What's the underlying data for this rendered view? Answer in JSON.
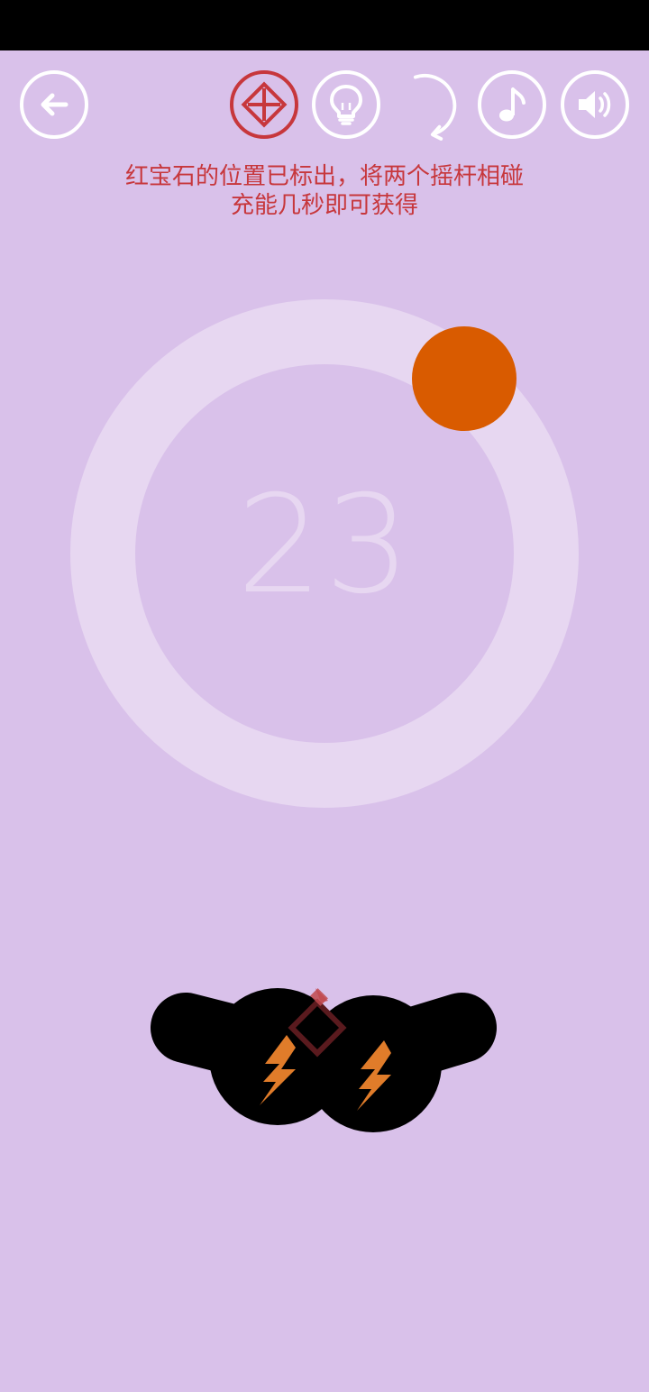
{
  "hint": {
    "line1": "红宝石的位置已标出，将两个摇杆相碰",
    "line2": "充能几秒即可获得"
  },
  "game": {
    "counter": "23",
    "ring_progress": 1.0
  },
  "toolbar": {
    "icons": [
      "back-arrow-icon",
      "ruby-target-icon",
      "lightbulb-icon",
      "restart-icon",
      "music-note-icon",
      "speaker-icon"
    ]
  },
  "colors": {
    "background": "#d9c1ea",
    "ring": "#e7d7f1",
    "orb": "#d95b00",
    "hint_text": "#c7373c",
    "ruby_button": "#c7373c",
    "joystick": "#000000",
    "bolt": "#e07c2a",
    "diamond": "#5a1a1e"
  }
}
